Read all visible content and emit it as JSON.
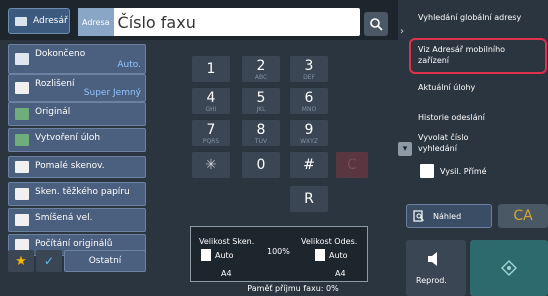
{
  "header": {
    "address_book_label": "Adresář",
    "address_tag": "Adresa",
    "fax_placeholder": "Číslo faxu"
  },
  "left_buttons": [
    {
      "label": "Dokončeno",
      "value": "Auto."
    },
    {
      "label": "Rozlišení",
      "value": "Super Jemný"
    },
    {
      "label": "Originál",
      "value": ""
    },
    {
      "label": "Vytvoření úloh",
      "value": ""
    },
    {
      "label": "Pomalé skenov.",
      "value": ""
    },
    {
      "label": "Sken. těžkého papíru",
      "value": ""
    },
    {
      "label": "Smíšená vel.",
      "value": ""
    },
    {
      "label": "Počítání originálů",
      "value": ""
    }
  ],
  "bottom_left": {
    "other_label": "Ostatní"
  },
  "keypad": [
    {
      "main": "1",
      "sub": ""
    },
    {
      "main": "2",
      "sub": "ABC"
    },
    {
      "main": "3",
      "sub": "DEF"
    },
    {
      "main": "4",
      "sub": "GHI"
    },
    {
      "main": "5",
      "sub": "JKL"
    },
    {
      "main": "6",
      "sub": "MNO"
    },
    {
      "main": "7",
      "sub": "PQRS"
    },
    {
      "main": "8",
      "sub": "TUV"
    },
    {
      "main": "9",
      "sub": "WXYZ"
    },
    {
      "main": "✳",
      "sub": ""
    },
    {
      "main": "0",
      "sub": ""
    },
    {
      "main": "#",
      "sub": ""
    },
    {
      "main": "C",
      "sub": ""
    },
    {
      "main": "R",
      "sub": ""
    }
  ],
  "info": {
    "scan_size_label": "Velikost Sken.",
    "send_size_label": "Velikost Odes.",
    "zoom": "100%",
    "scan_auto": "Auto",
    "scan_paper": "A4",
    "send_auto": "Auto",
    "send_paper": "A4",
    "memory_label": "Paměť příjmu faxu: 0%"
  },
  "right_panel": {
    "global_search": "Vyhledání globální adresy",
    "mobile_address_book": "Viz Adresář mobilního zařízení",
    "current_jobs": "Aktuální úlohy",
    "send_history": "Historie odeslání",
    "recall_number": "Vyvolat číslo vyhledání",
    "direct_send": "Vysil. Přímé",
    "preview": "Náhled",
    "ca": "CA",
    "reprod": "Reprod."
  }
}
